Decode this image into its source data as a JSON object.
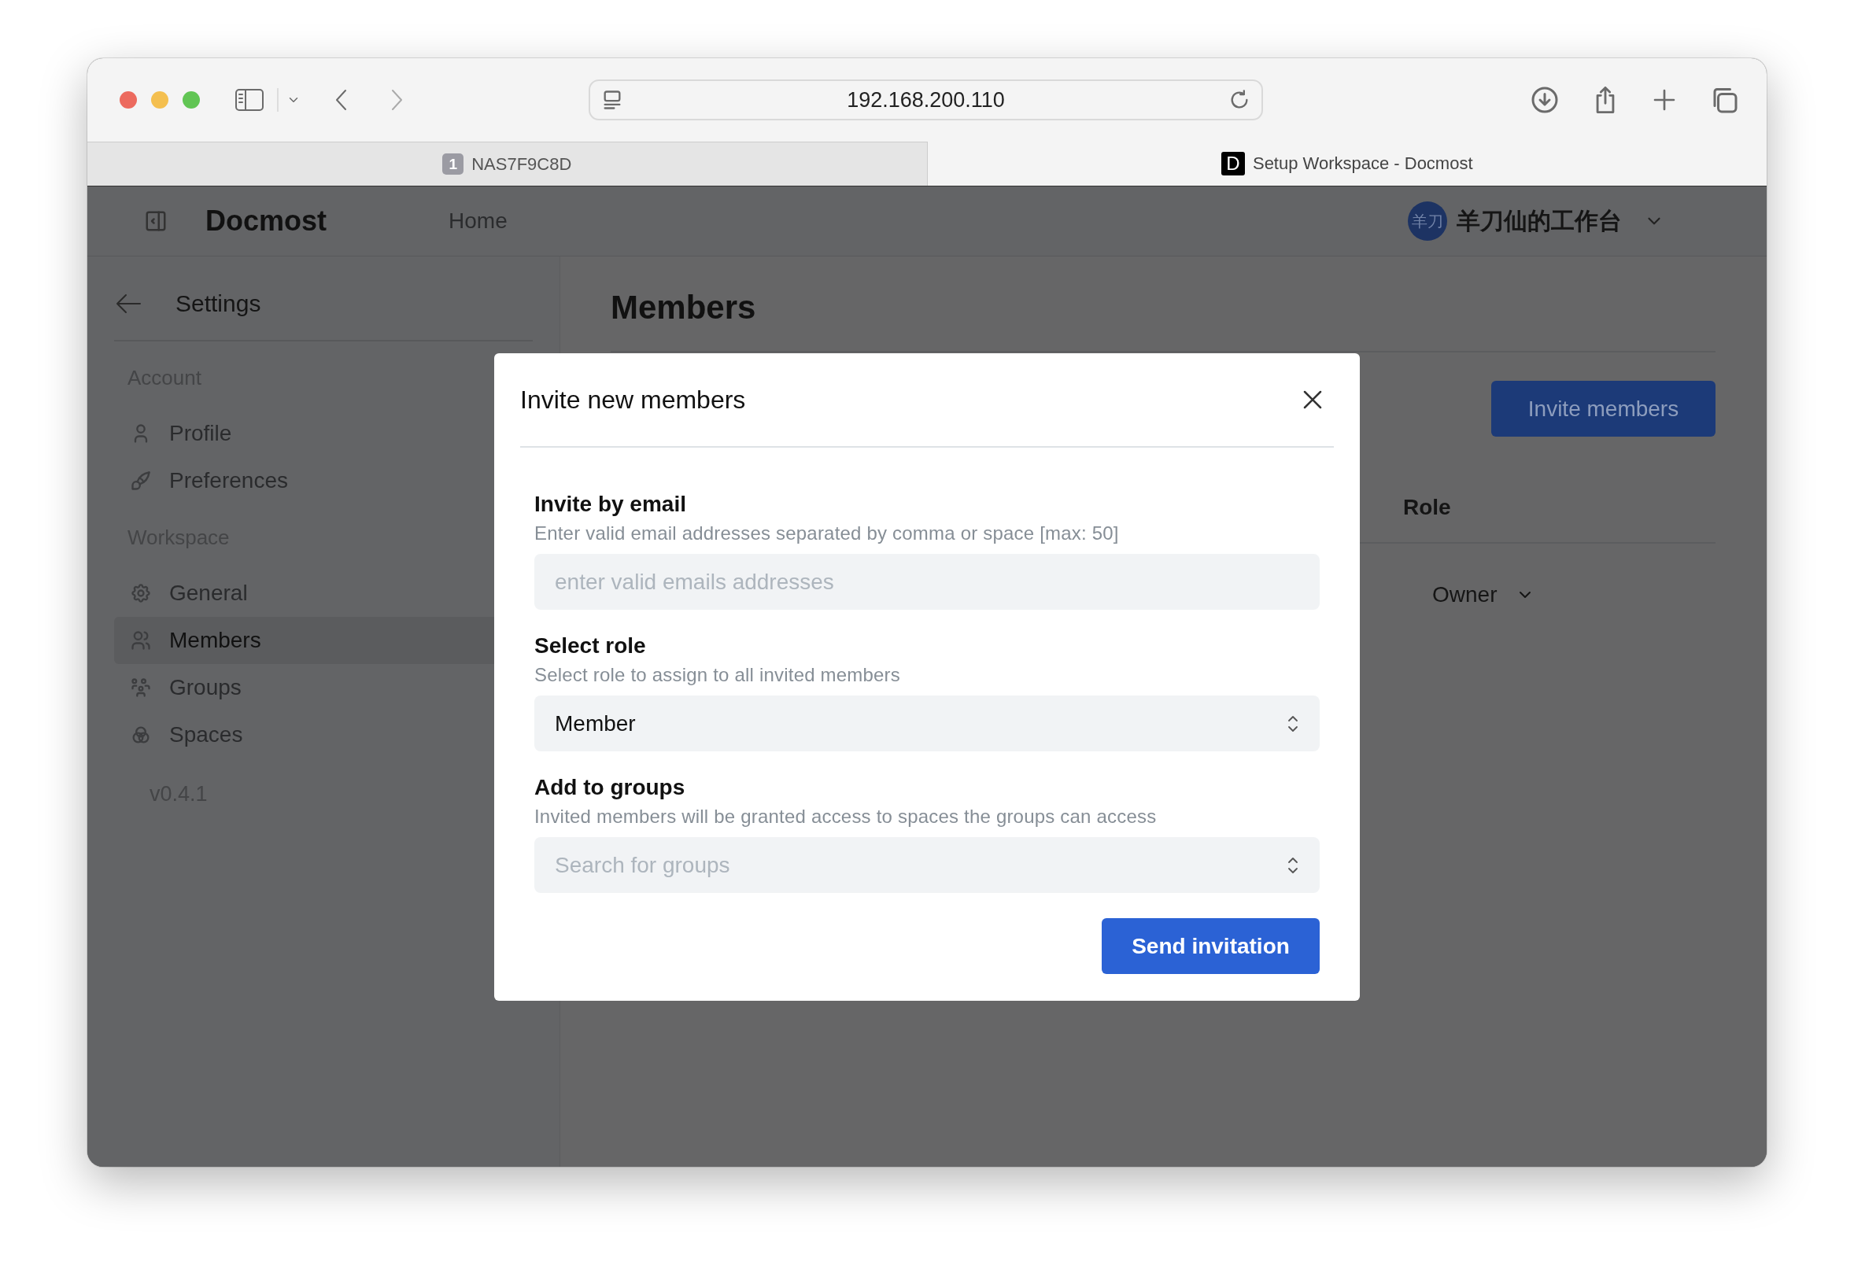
{
  "browser": {
    "address": "192.168.200.110",
    "tabs": [
      {
        "label": "NAS7F9C8D",
        "badge": "1",
        "selected": false
      },
      {
        "label": "Setup Workspace - Docmost",
        "favicon": "D",
        "selected": true
      }
    ]
  },
  "header": {
    "brand": "Docmost",
    "nav": [
      "Home"
    ],
    "workspace": {
      "initials": "羊刀",
      "name": "羊刀仙的工作台"
    }
  },
  "sidebar": {
    "title": "Settings",
    "sections": [
      {
        "heading": "Account",
        "items": [
          {
            "label": "Profile",
            "selected": false
          },
          {
            "label": "Preferences",
            "selected": false
          }
        ]
      },
      {
        "heading": "Workspace",
        "items": [
          {
            "label": "General",
            "selected": false
          },
          {
            "label": "Members",
            "selected": true
          },
          {
            "label": "Groups",
            "selected": false
          },
          {
            "label": "Spaces",
            "selected": false
          }
        ]
      }
    ],
    "version": "v0.4.1"
  },
  "main": {
    "title": "Members",
    "invite_button": "Invite members",
    "table": {
      "columns": [
        "Role"
      ],
      "rows": [
        [
          "Owner"
        ]
      ]
    }
  },
  "modal": {
    "title": "Invite new members",
    "fields": [
      {
        "kind": "text",
        "label": "Invite by email",
        "description": "Enter valid email addresses separated by comma or space [max: 50]",
        "placeholder": "enter valid emails addresses"
      },
      {
        "kind": "select",
        "label": "Select role",
        "description": "Select role to assign to all invited members",
        "value": "Member"
      },
      {
        "kind": "select",
        "label": "Add to groups",
        "description": "Invited members will be granted access to spaces the groups can access",
        "placeholder": "Search for groups"
      }
    ],
    "submit": "Send invitation"
  }
}
